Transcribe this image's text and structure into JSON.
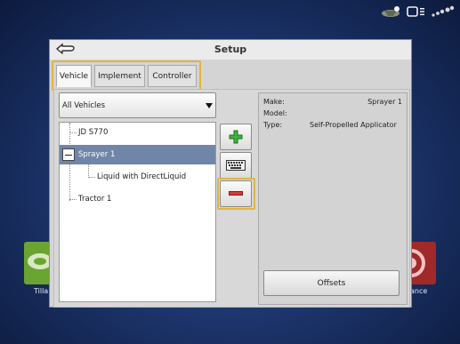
{
  "status_bar": {
    "icons": [
      "gps-status-icon",
      "display-status-icon",
      "wireless-status-icon"
    ]
  },
  "background_apps": [
    {
      "label": "Tilla"
    },
    {
      "label": "ance"
    }
  ],
  "dialog": {
    "title": "Setup",
    "tabs": [
      {
        "label": "Vehicle",
        "active": true
      },
      {
        "label": "Implement",
        "active": false
      },
      {
        "label": "Controller",
        "active": false
      }
    ],
    "filter": {
      "selected": "All Vehicles"
    },
    "tree": [
      {
        "label": "JD S770",
        "level": 0,
        "selected": false
      },
      {
        "label": "Sprayer 1",
        "level": 0,
        "selected": true,
        "expanded": true
      },
      {
        "label": "Liquid with DirectLiquid",
        "level": 1,
        "selected": false
      },
      {
        "label": "Tractor 1",
        "level": 0,
        "selected": false
      }
    ],
    "details": {
      "make_label": "Make:",
      "make_value": "Sprayer 1",
      "model_label": "Model:",
      "model_value": "",
      "type_label": "Type:",
      "type_value": "Self-Propelled Applicator"
    },
    "offsets_label": "Offsets"
  },
  "colors": {
    "highlight": "#e0b440",
    "selection": "#6f86a8",
    "add": "#3fb23f",
    "remove": "#d23a3a"
  }
}
